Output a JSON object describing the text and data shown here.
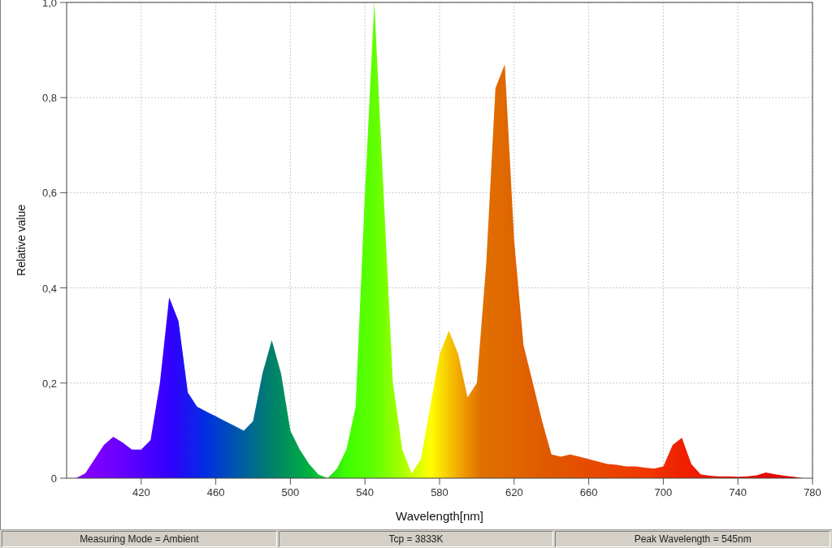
{
  "chart_data": {
    "type": "area",
    "xlabel": "Wavelength[nm]",
    "ylabel": "Relative value",
    "x": [
      385,
      390,
      395,
      400,
      405,
      410,
      415,
      420,
      425,
      430,
      435,
      440,
      445,
      450,
      455,
      460,
      465,
      470,
      475,
      480,
      485,
      490,
      495,
      500,
      505,
      510,
      515,
      520,
      525,
      530,
      535,
      540,
      545,
      550,
      555,
      560,
      565,
      570,
      575,
      580,
      585,
      590,
      595,
      600,
      605,
      610,
      615,
      620,
      625,
      630,
      635,
      640,
      645,
      650,
      655,
      660,
      665,
      670,
      675,
      680,
      685,
      690,
      695,
      700,
      705,
      710,
      715,
      720,
      725,
      730,
      735,
      740,
      745,
      750,
      755,
      760,
      765,
      770,
      775
    ],
    "grid": true,
    "series": [
      {
        "values": [
          0.0,
          0.01,
          0.04,
          0.07,
          0.087,
          0.075,
          0.06,
          0.06,
          0.08,
          0.2,
          0.38,
          0.33,
          0.18,
          0.15,
          0.14,
          0.13,
          0.12,
          0.11,
          0.1,
          0.12,
          0.22,
          0.29,
          0.22,
          0.1,
          0.06,
          0.03,
          0.008,
          0.0,
          0.02,
          0.06,
          0.15,
          0.6,
          1.0,
          0.6,
          0.2,
          0.06,
          0.01,
          0.04,
          0.15,
          0.26,
          0.31,
          0.26,
          0.17,
          0.2,
          0.45,
          0.82,
          0.87,
          0.5,
          0.28,
          0.2,
          0.12,
          0.05,
          0.045,
          0.05,
          0.045,
          0.04,
          0.035,
          0.03,
          0.028,
          0.025,
          0.025,
          0.022,
          0.02,
          0.025,
          0.07,
          0.085,
          0.03,
          0.008,
          0.005,
          0.004,
          0.004,
          0.003,
          0.004,
          0.006,
          0.012,
          0.008,
          0.005,
          0.003,
          0.0
        ]
      }
    ],
    "xlim": [
      380,
      780
    ],
    "ylim": [
      0,
      1
    ],
    "xticks": [
      420,
      460,
      500,
      540,
      580,
      620,
      660,
      700,
      740,
      780
    ],
    "yticks": [
      {
        "value": 0,
        "label": "0"
      },
      {
        "value": 0.2,
        "label": "0,2"
      },
      {
        "value": 0.4,
        "label": "0,4"
      },
      {
        "value": 0.6,
        "label": "0,6"
      },
      {
        "value": 0.8,
        "label": "0,8"
      },
      {
        "value": 1,
        "label": "1,0"
      }
    ]
  },
  "status_bar": [
    "Measuring Mode = Ambient",
    "Tcp = 3833K",
    "Peak Wavelength = 545nm"
  ]
}
